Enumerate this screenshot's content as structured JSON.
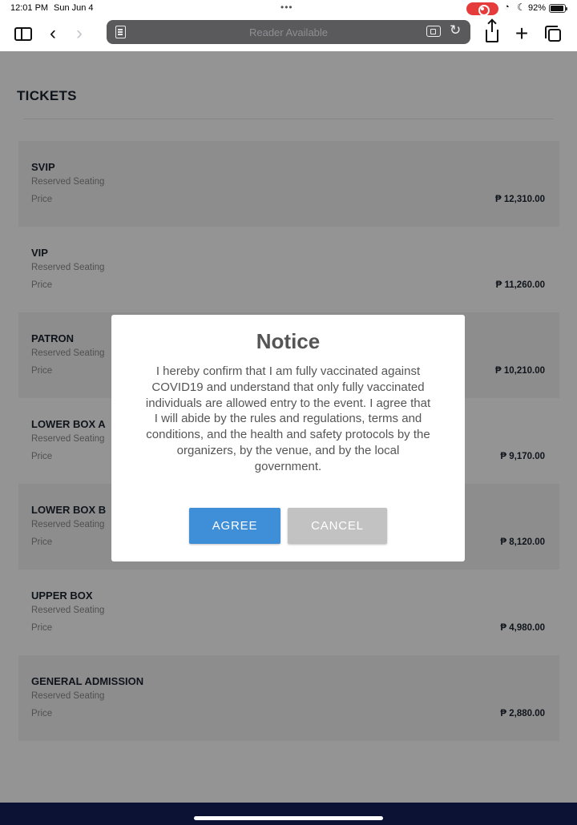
{
  "status_bar": {
    "time": "12:01 PM",
    "date": "Sun Jun 4",
    "dots": "•••",
    "battery": "92%"
  },
  "browser": {
    "address_text": "Reader Available",
    "icons": [
      "sidebar-icon",
      "back-icon",
      "forward-icon",
      "reader-icon",
      "extension-icon",
      "reload-icon",
      "share-icon",
      "plus-icon",
      "tabs-icon"
    ]
  },
  "page": {
    "title": "TICKETS",
    "tickets": [
      {
        "name": "SVIP",
        "seating": "Reserved Seating",
        "price_label": "Price",
        "price": "₱ 12,310.00"
      },
      {
        "name": "VIP",
        "seating": "Reserved Seating",
        "price_label": "Price",
        "price": "₱ 11,260.00"
      },
      {
        "name": "PATRON",
        "seating": "Reserved Seating",
        "price_label": "Price",
        "price": "₱ 10,210.00"
      },
      {
        "name": "LOWER BOX A",
        "seating": "Reserved Seating",
        "price_label": "Price",
        "price": "₱ 9,170.00"
      },
      {
        "name": "LOWER BOX B",
        "seating": "Reserved Seating",
        "price_label": "Price",
        "price": "₱ 8,120.00"
      },
      {
        "name": "UPPER BOX",
        "seating": "Reserved Seating",
        "price_label": "Price",
        "price": "₱ 4,980.00"
      },
      {
        "name": "GENERAL ADMISSION",
        "seating": "Reserved Seating",
        "price_label": "Price",
        "price": "₱ 2,880.00"
      }
    ]
  },
  "modal": {
    "title": "Notice",
    "body": "I hereby confirm that I am fully vaccinated against COVID19 and understand that only fully vaccinated individuals are allowed entry to the event. I agree that I will abide by the rules and regulations, terms and conditions, and the health and safety protocols by the organizers, by the venue, and by the local government.",
    "agree_label": "AGREE",
    "cancel_label": "CANCEL"
  },
  "colors": {
    "agree": "#3f8ed8",
    "cancel": "#c2c2c2",
    "bottom_bar": "#0b1233",
    "record_indicator": "#e63b3b"
  }
}
